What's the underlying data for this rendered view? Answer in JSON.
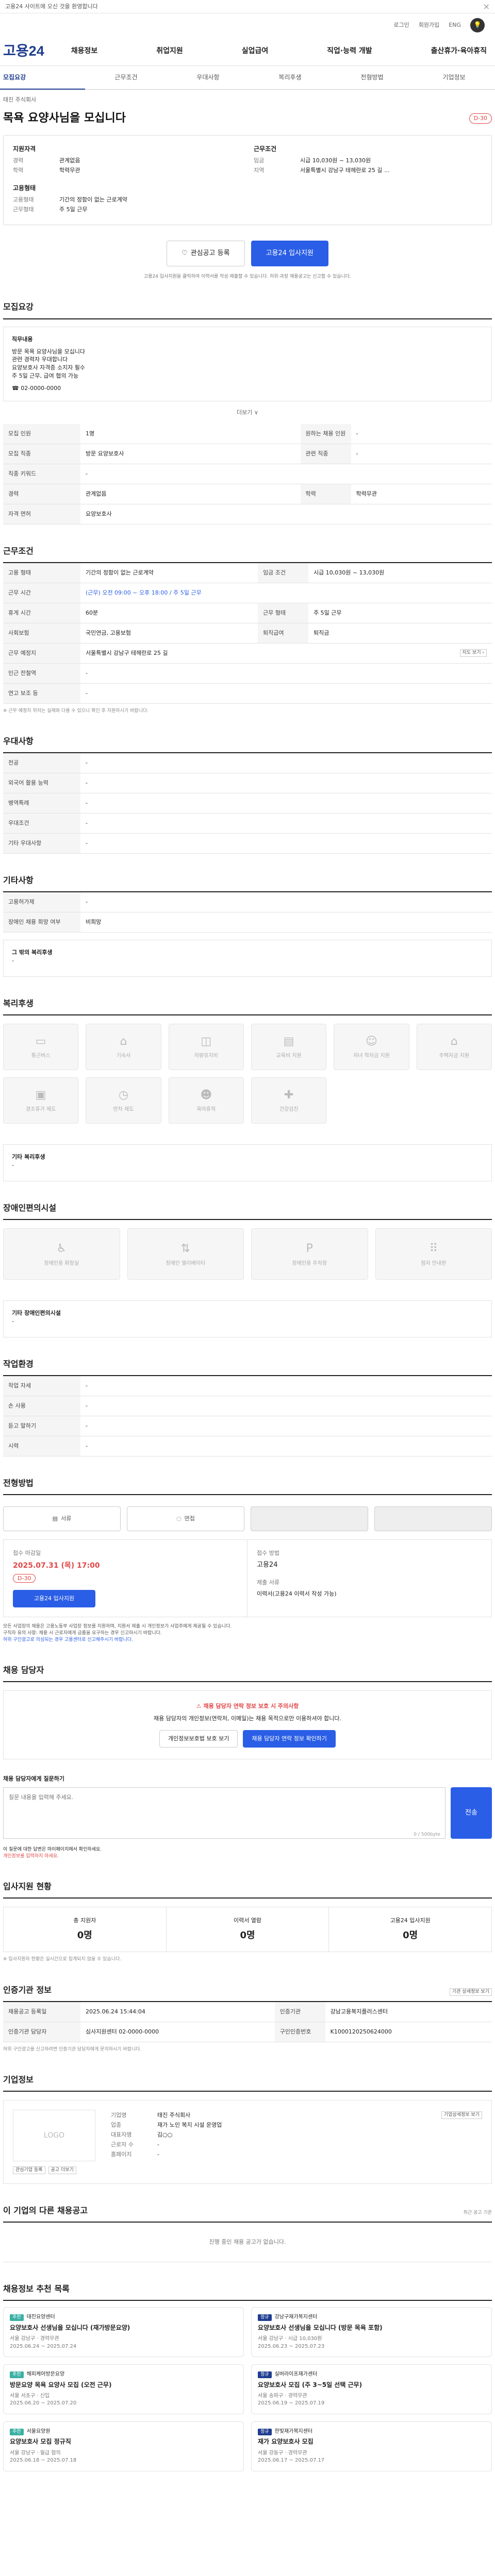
{
  "topstrip": {
    "text": "고용24 사이트에 오신 것을 환영합니다",
    "close": "×"
  },
  "util": {
    "a": "로그인",
    "b": "회원가입",
    "c": "ENG",
    "bulb": "💡"
  },
  "gnb": {
    "logo": "고용24",
    "menu": [
      "채용정보",
      "취업지원",
      "실업급여",
      "직업·능력 개발",
      "출산휴가·육아휴직"
    ]
  },
  "tabs": [
    "모집요강",
    "근무조건",
    "우대사항",
    "복리후생",
    "전형방법",
    "기업정보"
  ],
  "job": {
    "company_label": "태진 주식회사",
    "title": "목욕 요양사님을 모십니다",
    "dday": "D-30",
    "left_title": "지원자격",
    "left": [
      [
        "경력",
        "관계없음"
      ],
      [
        "학력",
        "학력무관"
      ]
    ],
    "left_title2": "고용형태",
    "left2": [
      [
        "고용형태",
        "기간의 정함이 없는 근로계약"
      ],
      [
        "근무형태",
        "주 5일 근무"
      ]
    ],
    "right_title": "근무조건",
    "right": [
      [
        "임금",
        "시급 10,030원 ~ 13,030원"
      ],
      [
        "지역",
        "서울특별시 강남구 테헤란로 25 길 ..."
      ]
    ],
    "btn_scrap": "관심공고 등록",
    "btn_apply": "고용24 입사지원",
    "note": "고용24 입사지원을 클릭하여 이력서를 작성·제출할 수 있습니다. 허위·과장 채용공고는 신고할 수 있습니다."
  },
  "recruit": {
    "header": "모집요강",
    "box_title": "직무내용",
    "box_lines": [
      "방문 목욕 요양사님을 모십니다",
      "관련 경력자 우대합니다",
      "요양보호사 자격증 소지자 필수",
      "주 5일 근무, 급여 협의 가능"
    ],
    "contact": "☎ 02-0000-0000",
    "more": "더보기 ∨",
    "rows": [
      [
        "모집 인원",
        "1명",
        "원하는 채용 인원",
        "-"
      ],
      [
        "모집 직종",
        "방문 요양보호사",
        "관련 직종",
        "-"
      ],
      [
        "직종 키워드",
        "-",
        "",
        ""
      ],
      [
        "경력",
        "관계없음",
        "학력",
        "학력무관"
      ],
      [
        "자격 면허",
        "요양보호사",
        "",
        ""
      ]
    ]
  },
  "conditions": {
    "header": "근무조건",
    "rows": [
      [
        "고용 형태",
        "기간의 정함이 없는 근로계약",
        "임금 조건",
        "시급 10,030원 ~ 13,030원"
      ],
      [
        "근무 시간",
        "(근무) 오전 09:00 ~ 오후 18:00 / 주 5일 근무",
        "",
        ""
      ],
      [
        "휴게 시간",
        "60분",
        "근무 형태",
        "주 5일 근무"
      ],
      [
        "사회보험",
        "국민연금, 고용보험",
        "퇴직급여",
        "퇴직금"
      ],
      [
        "근무 예정지",
        "서울특별시 강남구 테헤란로 25 길",
        "",
        ""
      ],
      [
        "인근 전철역",
        "-",
        "",
        ""
      ],
      [
        "연고 보조 등",
        "-",
        "",
        ""
      ]
    ],
    "map_btn": "지도 보기 ›",
    "footnote": "※ 근무 예정지 위치는 실제와 다를 수 있으니 확인 후 지원하시기 바랍니다."
  },
  "preference": {
    "header": "우대사항",
    "rows": [
      [
        "전공",
        "-"
      ],
      [
        "외국어 활용 능력",
        "-"
      ],
      [
        "병역특례",
        "-"
      ],
      [
        "우대조건",
        "-"
      ],
      [
        "기타 우대사항",
        "-"
      ]
    ]
  },
  "other": {
    "header": "기타사항",
    "rows": [
      [
        "고용허가제",
        "-"
      ],
      [
        "장애인 채용 희망 여부",
        "비희망"
      ]
    ],
    "box_label": "그 밖의 복리후생",
    "box_value": "-"
  },
  "welfare": {
    "header": "복리후생",
    "tiles": [
      "통근버스",
      "기숙사",
      "차량유지비",
      "교육비 지원",
      "자녀 학자금 지원",
      "주택자금 지원",
      "경조휴가 제도",
      "반차 제도",
      "육아휴직",
      "건강검진"
    ],
    "box_label": "기타 복리후생",
    "box_value": "-"
  },
  "disability": {
    "header": "장애인편의시설",
    "tiles": [
      "장애인용 화장실",
      "장애인 엘리베이터",
      "장애인용 주차장",
      "점자 안내판"
    ],
    "box_label": "기타 장애인편의시설",
    "box_value": "-"
  },
  "workplace": {
    "header": "작업환경",
    "rows": [
      [
        "작업 자세",
        "-",
        "",
        ""
      ],
      [
        "손 사용",
        "-",
        "",
        ""
      ],
      [
        "듣고 말하기",
        "-",
        "",
        ""
      ],
      [
        "시력",
        "-",
        "",
        ""
      ]
    ]
  },
  "process": {
    "header": "전형방법",
    "steps": [
      "서류",
      "면접",
      "",
      ""
    ],
    "deadline_label": "접수 마감일",
    "deadline": "2025.07.31 (목) 17:00",
    "deadline_badge": "D-30",
    "apply_btn": "고용24 입사지원",
    "method_label": "접수 방법",
    "method": "고용24",
    "docs_label": "제출 서류",
    "docs": "이력서(고용24 이력서 작성 가능)",
    "footnotes": [
      "모든 사업장의 채용은 고용노동부 사업장 정보를 지원하며, 지원서 제출 시 개인정보가 사업주에게 제공될 수 있습니다.",
      "구직자 유의 사항: 채용 시 근로자에게 금품을 요구하는 경우 신고하시기 바랍니다.",
      "허위 구인광고로 의심되는 경우 고용센터로 신고해주시기 바랍니다."
    ]
  },
  "contact": {
    "header": "채용 담당자",
    "warn_title": "채용 담당자 연락 정보 보호 시 주의사항",
    "warn_text": "채용 담당자의 개인정보(연락처, 이메일)는 채용 목적으로만 이용하셔야 합니다.",
    "btn_a": "개인정보보호법 보호 보기",
    "btn_b": "채용 담당자 연락 정보 확인하기"
  },
  "inquiry": {
    "label": "채용 담당자에게 질문하기",
    "placeholder": "질문 내용을 입력해 주세요.",
    "counter": "0 / 500byte",
    "submit": "전송",
    "notes": [
      "이 질문에 대한 답변은 마이페이지에서 확인하세요.",
      "개인정보를 입력하지 마세요."
    ]
  },
  "stats": {
    "header": "입사지원 현황",
    "items": [
      [
        "총 지원자",
        "0명"
      ],
      [
        "이력서 열람",
        "0명"
      ],
      [
        "고용24 입사지원",
        "0명"
      ]
    ],
    "note": "※ 입사지원자 현황은 실시간으로 집계되지 않을 수 있습니다."
  },
  "agency": {
    "header": "인증기관 정보",
    "btn": "기관 상세정보 보기",
    "rows": [
      [
        "채용공고 등록일",
        "2025.06.24 15:44:04",
        "인증기관",
        "강남고용복지플러스센터"
      ],
      [
        "인증기관 담당자",
        "심사지원센터 02-0000-0000",
        "구인인증번호",
        "K1000120250624000"
      ]
    ],
    "note": "허위 구인광고를 신고하려면 인증기관 담당자에게 문의하시기 바랍니다."
  },
  "company": {
    "header": "기업정보",
    "logo": "LOGO",
    "name": "태진 주식회사",
    "btns": [
      "관심기업 등록",
      "공고 더보기"
    ],
    "rows": [
      [
        "기업명",
        "태진 주식회사"
      ],
      [
        "업종",
        "재가 노인 복지 시설 운영업"
      ],
      [
        "대표자명",
        "김○○"
      ],
      [
        "근로자 수",
        "-"
      ],
      [
        "홈페이지",
        "-"
      ]
    ],
    "detail_btn": "기업상세정보 보기"
  },
  "similar": {
    "header": "이 기업의 다른 채용공고",
    "empty": "진행 중인 채용 공고가 없습니다.",
    "note": "최근 공고 기준"
  },
  "recommend": {
    "header": "채용정보 추천 목록",
    "cards": [
      {
        "tag": "추천",
        "co": "태진요양센터",
        "title": "요양보호사 선생님을 모십니다 (재가방문요양)",
        "meta": "서울 강남구 · 경력무관",
        "date": "2025.06.24 ~ 2025.07.24"
      },
      {
        "tag": "정규",
        "co": "강남구재가복지센터",
        "title": "요양보호사 선생님을 모십니다 (방문 목욕 포함)",
        "meta": "서울 강남구 · 시급 10,030원",
        "date": "2025.06.23 ~ 2025.07.23"
      },
      {
        "tag": "추천",
        "co": "해피케어방문요양",
        "title": "방문요양 목욕 요양사 모집 (오전 근무)",
        "meta": "서울 서초구 · 신입",
        "date": "2025.06.20 ~ 2025.07.20"
      },
      {
        "tag": "정규",
        "co": "실버라이프재가센터",
        "title": "요양보호사 모집 (주 3~5일 선택 근무)",
        "meta": "서울 송파구 · 경력무관",
        "date": "2025.06.19 ~ 2025.07.19"
      },
      {
        "tag": "추천",
        "co": "서울요양원",
        "title": "요양보호사 모집 정규직",
        "meta": "서울 강남구 · 월급 협의",
        "date": "2025.06.18 ~ 2025.07.18"
      },
      {
        "tag": "정규",
        "co": "한빛재가복지센터",
        "title": "재가 요양보호사 모집",
        "meta": "서울 강동구 · 경력무관",
        "date": "2025.06.17 ~ 2025.07.17"
      }
    ]
  }
}
